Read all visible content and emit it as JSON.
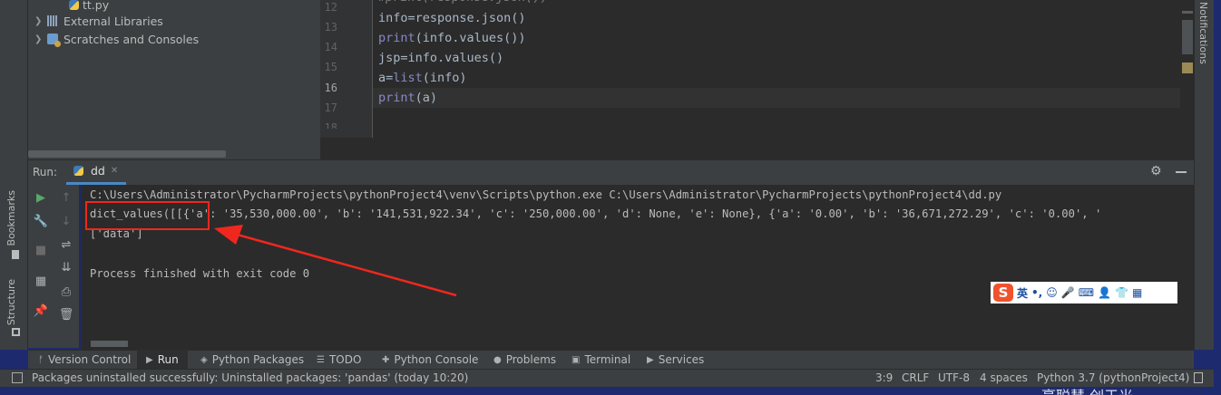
{
  "left_stripe": {
    "bookmarks": "Bookmarks",
    "structure": "Structure"
  },
  "right_stripe": {
    "notifications": "Notifications"
  },
  "project_tree": [
    {
      "label": "tt.py",
      "icon": "python-file-icon"
    },
    {
      "label": "External Libraries",
      "icon": "library-icon"
    },
    {
      "label": "Scratches and Consoles",
      "icon": "scratches-icon"
    }
  ],
  "editor": {
    "line_numbers": [
      "12",
      "13",
      "14",
      "15",
      "16",
      "17",
      "18"
    ],
    "lines": [
      {
        "pre": "info=response.json()",
        "kw": "",
        "post": ""
      },
      {
        "pre": "",
        "kw": "print",
        "post": "(info.values())"
      },
      {
        "pre": "jsp=info.values()",
        "kw": "",
        "post": ""
      },
      {
        "pre": "a=",
        "kw": "list",
        "post": "(info)"
      },
      {
        "pre": "",
        "kw": "print",
        "post": "(a)"
      }
    ],
    "partial_top_line": "#print(response.json())"
  },
  "run_window": {
    "title": "Run:",
    "tab_label": "dd",
    "console": [
      "C:\\Users\\Administrator\\PycharmProjects\\pythonProject4\\venv\\Scripts\\python.exe C:\\Users\\Administrator\\PycharmProjects\\pythonProject4\\dd.py",
      "dict_values([[{'a': '35,530,000.00', 'b': '141,531,922.34', 'c': '250,000.00', 'd': None, 'e': None}, {'a': '0.00', 'b': '36,671,272.29', 'c': '0.00', '",
      "['data']",
      "",
      "Process finished with exit code 0"
    ]
  },
  "ime": {
    "logo": "S",
    "mode": "英",
    "punct": "•,",
    "emoji": "☺",
    "mic": "🎤",
    "keyboard": "⌨",
    "user": "👤",
    "shirt": "👕",
    "grid": "▦"
  },
  "tool_tabs": [
    {
      "label": "Version Control",
      "icon": "ᚠ"
    },
    {
      "label": "Run",
      "icon": "▶"
    },
    {
      "label": "Python Packages",
      "icon": "◈"
    },
    {
      "label": "TODO",
      "icon": "☰"
    },
    {
      "label": "Python Console",
      "icon": "✚"
    },
    {
      "label": "Problems",
      "icon": "●"
    },
    {
      "label": "Terminal",
      "icon": "▣"
    },
    {
      "label": "Services",
      "icon": "▶"
    }
  ],
  "status_bar": {
    "message": "Packages uninstalled successfully: Uninstalled packages: 'pandas' (today 10:20)",
    "position": "3:9",
    "line_sep": "CRLF",
    "encoding": "UTF-8",
    "indent": "4 spaces",
    "interpreter": "Python 3.7 (pythonProject4)"
  },
  "desktop_text": "豪聪慧 创于光",
  "colors": {
    "accent": "#4a88c7",
    "annotation_red": "#f0271e",
    "editor_bg": "#2b2b2b",
    "panel_bg": "#3c3f41"
  }
}
